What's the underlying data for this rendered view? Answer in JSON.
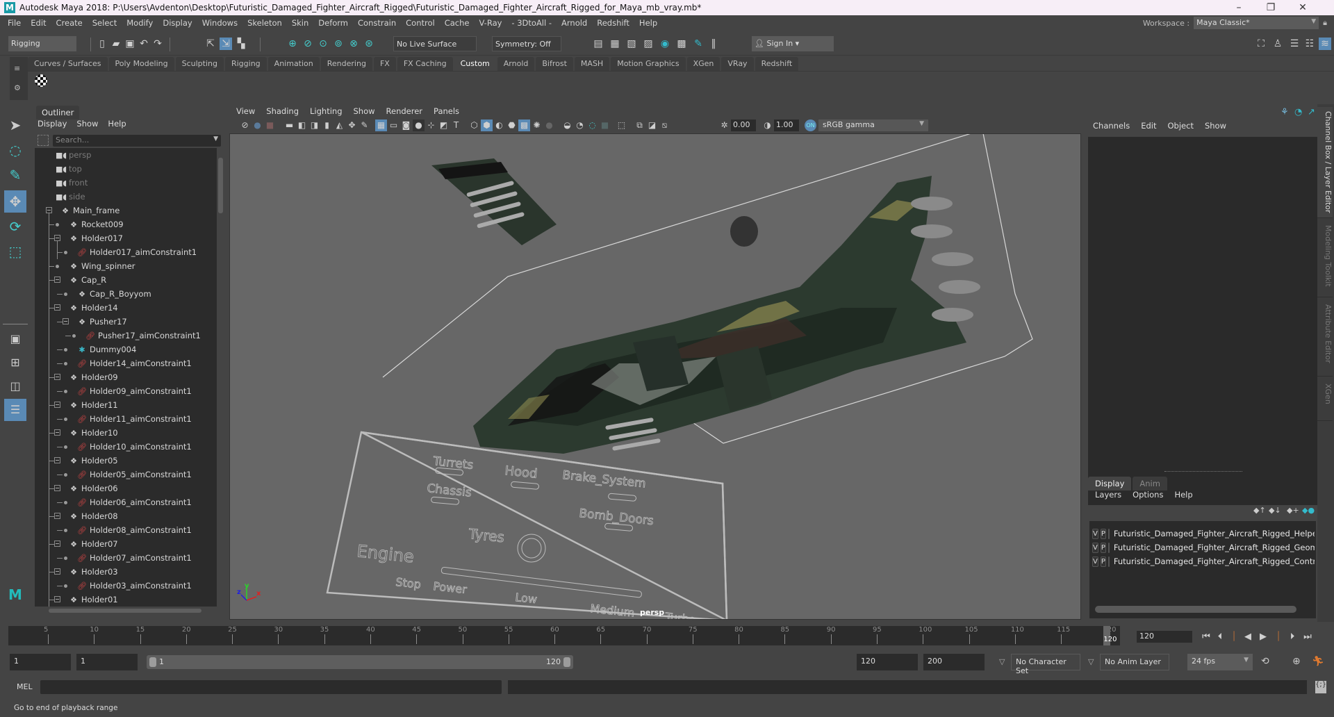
{
  "window": {
    "title": "Autodesk Maya 2018: P:\\Users\\Avdenton\\Desktop\\Futuristic_Damaged_Fighter_Aircraft_Rigged\\Futuristic_Damaged_Fighter_Aircraft_Rigged_for_Maya_mb_vray.mb*",
    "logo": "M",
    "minimize": "–",
    "maximize": "❐",
    "close": "✕"
  },
  "menubar": [
    "File",
    "Edit",
    "Create",
    "Select",
    "Modify",
    "Display",
    "Windows",
    "Skeleton",
    "Skin",
    "Deform",
    "Constrain",
    "Control",
    "Cache",
    "V-Ray",
    "- 3DtoAll -",
    "Arnold",
    "Redshift",
    "Help"
  ],
  "workspace": {
    "label": "Workspace :",
    "value": "Maya Classic*"
  },
  "statusline": {
    "menuset": "Rigging",
    "live_surface": "No Live Surface",
    "symmetry": "Symmetry: Off",
    "sign_in": "Sign In"
  },
  "shelf": {
    "tabs": [
      "Curves / Surfaces",
      "Poly Modeling",
      "Sculpting",
      "Rigging",
      "Animation",
      "Rendering",
      "FX",
      "FX Caching",
      "Custom",
      "Arnold",
      "Bifrost",
      "MASH",
      "Motion Graphics",
      "XGen",
      "VRay",
      "Redshift"
    ],
    "active_tab": "Custom"
  },
  "outliner": {
    "title": "Outliner",
    "menu": [
      "Display",
      "Show",
      "Help"
    ],
    "search_placeholder": "Search...",
    "items": [
      {
        "label": "persp",
        "type": "camera",
        "depth": 0
      },
      {
        "label": "top",
        "type": "camera",
        "depth": 0
      },
      {
        "label": "front",
        "type": "camera",
        "depth": 0
      },
      {
        "label": "side",
        "type": "camera",
        "depth": 0
      },
      {
        "label": "Main_frame",
        "type": "transform",
        "depth": 0,
        "expanded": true
      },
      {
        "label": "Rocket009",
        "type": "transform",
        "depth": 1
      },
      {
        "label": "Holder017",
        "type": "transform",
        "depth": 1,
        "expanded": true
      },
      {
        "label": "Holder017_aimConstraint1",
        "type": "constraint",
        "depth": 2
      },
      {
        "label": "Wing_spinner",
        "type": "transform",
        "depth": 1
      },
      {
        "label": "Cap_R",
        "type": "transform",
        "depth": 1,
        "expanded": true
      },
      {
        "label": "Cap_R_Boyyom",
        "type": "transform",
        "depth": 2
      },
      {
        "label": "Holder14",
        "type": "transform",
        "depth": 1,
        "expanded": true
      },
      {
        "label": "Pusher17",
        "type": "transform",
        "depth": 2,
        "expanded": true
      },
      {
        "label": "Pusher17_aimConstraint1",
        "type": "constraint",
        "depth": 3
      },
      {
        "label": "Dummy004",
        "type": "dummy",
        "depth": 2
      },
      {
        "label": "Holder14_aimConstraint1",
        "type": "constraint",
        "depth": 2
      },
      {
        "label": "Holder09",
        "type": "transform",
        "depth": 1,
        "expanded": true
      },
      {
        "label": "Holder09_aimConstraint1",
        "type": "constraint",
        "depth": 2
      },
      {
        "label": "Holder11",
        "type": "transform",
        "depth": 1,
        "expanded": true
      },
      {
        "label": "Holder11_aimConstraint1",
        "type": "constraint",
        "depth": 2
      },
      {
        "label": "Holder10",
        "type": "transform",
        "depth": 1,
        "expanded": true
      },
      {
        "label": "Holder10_aimConstraint1",
        "type": "constraint",
        "depth": 2
      },
      {
        "label": "Holder05",
        "type": "transform",
        "depth": 1,
        "expanded": true
      },
      {
        "label": "Holder05_aimConstraint1",
        "type": "constraint",
        "depth": 2
      },
      {
        "label": "Holder06",
        "type": "transform",
        "depth": 1,
        "expanded": true
      },
      {
        "label": "Holder06_aimConstraint1",
        "type": "constraint",
        "depth": 2
      },
      {
        "label": "Holder08",
        "type": "transform",
        "depth": 1,
        "expanded": true
      },
      {
        "label": "Holder08_aimConstraint1",
        "type": "constraint",
        "depth": 2
      },
      {
        "label": "Holder07",
        "type": "transform",
        "depth": 1,
        "expanded": true
      },
      {
        "label": "Holder07_aimConstraint1",
        "type": "constraint",
        "depth": 2
      },
      {
        "label": "Holder03",
        "type": "transform",
        "depth": 1,
        "expanded": true
      },
      {
        "label": "Holder03_aimConstraint1",
        "type": "constraint",
        "depth": 2
      },
      {
        "label": "Holder01",
        "type": "transform",
        "depth": 1,
        "expanded": true
      }
    ]
  },
  "viewport": {
    "menu": [
      "View",
      "Shading",
      "Lighting",
      "Show",
      "Renderer",
      "Panels"
    ],
    "exposure": "0.00",
    "gamma": "1.00",
    "color_mgmt_toggle": "ON",
    "color_space": "sRGB gamma",
    "camera_label": "persp",
    "axis": {
      "x": "x",
      "y": "y",
      "z": "z"
    },
    "control_panel": {
      "labels": [
        "Turrets",
        "Hood",
        "Brake_System",
        "Chassis",
        "Bomb_Doors",
        "Tyres",
        "Engine"
      ],
      "engine_steps": [
        "Stop",
        "Power",
        "Low",
        "Medium",
        "Turbo"
      ]
    }
  },
  "channel_box": {
    "menu": [
      "Channels",
      "Edit",
      "Object",
      "Show"
    ]
  },
  "layer_editor": {
    "tabs": [
      "Display",
      "Anim"
    ],
    "active_tab": "Display",
    "menu": [
      "Layers",
      "Options",
      "Help"
    ],
    "layers": [
      {
        "v": "V",
        "p": "P",
        "color": "#0000ff",
        "name": "Futuristic_Damaged_Fighter_Aircraft_Rigged_Helpers"
      },
      {
        "v": "V",
        "p": "P",
        "color": "#000066",
        "name": "Futuristic_Damaged_Fighter_Aircraft_Rigged_Geometry"
      },
      {
        "v": "V",
        "p": "P",
        "color": "#a00030",
        "name": "Futuristic_Damaged_Fighter_Aircraft_Rigged_Controllers"
      }
    ]
  },
  "side_tabs": [
    "Channel Box / Layer Editor",
    "Modeling Toolkit",
    "Attribute Editor",
    "XGen"
  ],
  "timeline": {
    "start": 1,
    "end": 120,
    "tick_labels": [
      5,
      10,
      15,
      20,
      25,
      30,
      35,
      40,
      45,
      50,
      55,
      60,
      65,
      70,
      75,
      80,
      85,
      90,
      95,
      100,
      105,
      110,
      115,
      120
    ],
    "current_frame": "120",
    "current_frame_marker": "120"
  },
  "range": {
    "start_time": "1",
    "playback_start": "1",
    "slider_start": "1",
    "slider_end": "120",
    "playback_end": "120",
    "end_time": "200",
    "character_set": "No Character Set",
    "anim_layer": "No Anim Layer",
    "fps": "24 fps"
  },
  "command_line": {
    "label": "MEL"
  },
  "help_line": "Go to end of playback range"
}
